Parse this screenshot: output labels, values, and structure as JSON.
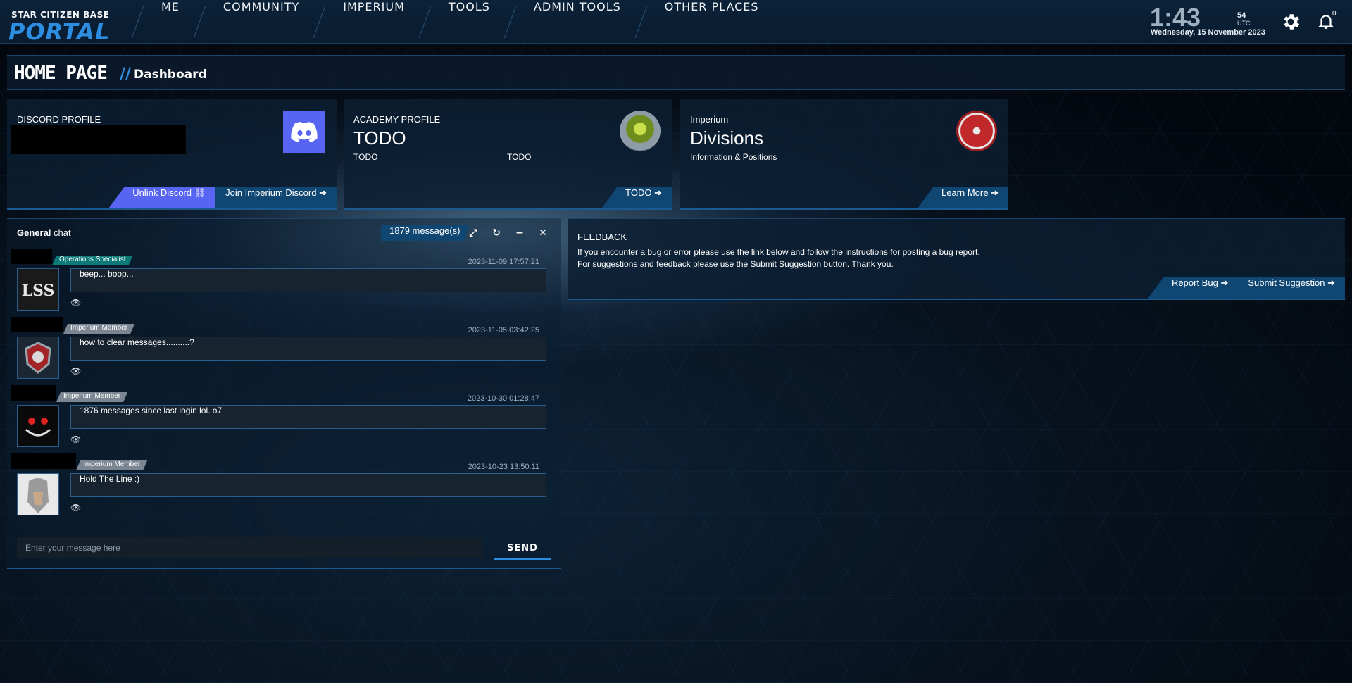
{
  "logo": {
    "line1": "STAR CITIZEN BASE",
    "line2": "PORTAL"
  },
  "nav": [
    "ME",
    "COMMUNITY",
    "IMPERIUM",
    "TOOLS",
    "ADMIN TOOLS",
    "OTHER PLACES"
  ],
  "clock": {
    "time": "1:43",
    "seconds": "54",
    "zone": "UTC",
    "date": "Wednesday, 15 November 2023"
  },
  "notifications": {
    "count": "0"
  },
  "header": {
    "title": "HOME PAGE",
    "separator": "//",
    "subtitle": "Dashboard"
  },
  "cards": {
    "discord": {
      "label": "DISCORD PROFILE",
      "btn_unlink": "Unlink Discord",
      "btn_join": "Join Imperium Discord"
    },
    "academy": {
      "label": "ACADEMY PROFILE",
      "title": "TODO",
      "sub1": "TODO",
      "sub2": "TODO",
      "btn": "TODO"
    },
    "imperium": {
      "label": "Imperium",
      "title": "Divisions",
      "sub": "Information & Positions",
      "btn": "Learn More"
    }
  },
  "chat": {
    "title_bold": "General",
    "title_rest": "chat",
    "count": "1879 message(s)",
    "messages": [
      {
        "role": "Operations Specialist",
        "role_color": "#0e7a78",
        "time": "2023-11-09 17:57:21",
        "text": "beep... boop..."
      },
      {
        "role": "Imperium Member",
        "role_color": "#7b8692",
        "time": "2023-11-05 03:42:25",
        "text": "how to clear messages..........?"
      },
      {
        "role": "Imperium Member",
        "role_color": "#7b8692",
        "time": "2023-10-30 01:28:47",
        "text": "1876 messages since last login lol. o7"
      },
      {
        "role": "Imperium Member",
        "role_color": "#7b8692",
        "time": "2023-10-23 13:50:11",
        "text": "Hold The Line :)"
      }
    ],
    "placeholder": "Enter your message here",
    "send": "SEND"
  },
  "feedback": {
    "title": "FEEDBACK",
    "line1": "If you encounter a bug or error please use the link below and follow the instructions for posting a bug report.",
    "line2": "For suggestions and feedback please use the Submit Suggestion button. Thank you.",
    "btn_bug": "Report Bug",
    "btn_suggest": "Submit Suggestion"
  }
}
